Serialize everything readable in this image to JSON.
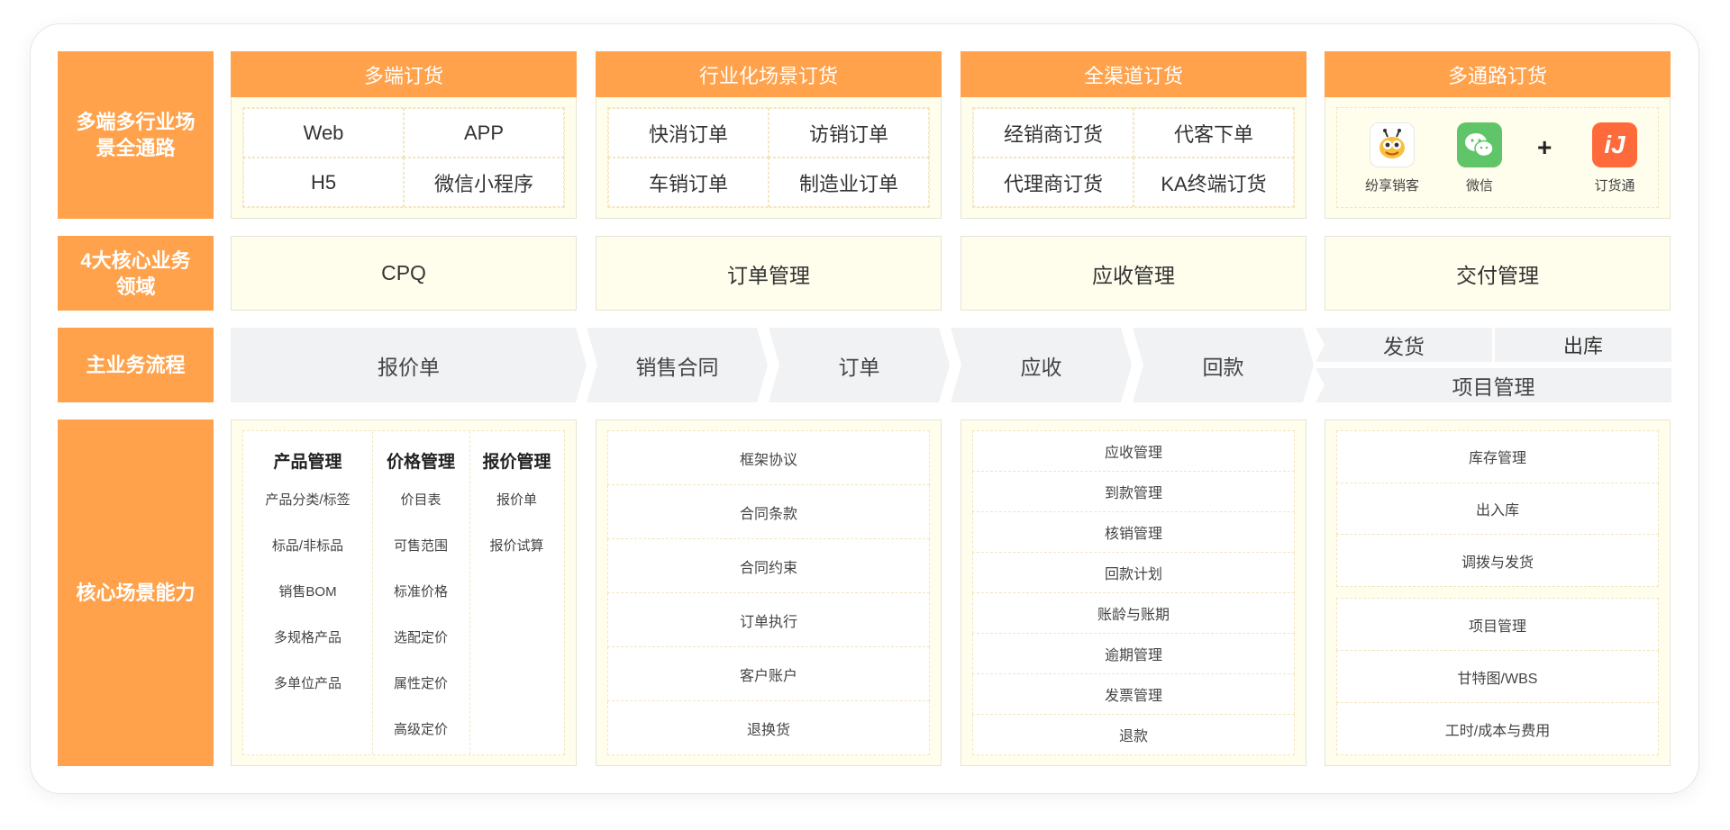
{
  "rows": {
    "channels": "多端多行业场景全通路",
    "domains": "4大核心业务领域",
    "process": "主业务流程",
    "capabilities": "核心场景能力"
  },
  "channels": [
    {
      "title": "多端订货",
      "items": [
        "Web",
        "APP",
        "H5",
        "微信小程序"
      ]
    },
    {
      "title": "行业化场景订货",
      "items": [
        "快消订单",
        "访销订单",
        "车销订单",
        "制造业订单"
      ]
    },
    {
      "title": "全渠道订货",
      "items": [
        "经销商订货",
        "代客下单",
        "代理商订货",
        "KA终端订货"
      ]
    },
    {
      "title": "多通路订货",
      "apps": [
        {
          "name": "纷享销客",
          "icon": "fenxiang-bee-icon",
          "color": "#f6c23e"
        },
        {
          "name": "微信",
          "icon": "wechat-icon",
          "color": "#5fc568"
        },
        {
          "name": "订货通",
          "icon": "dinghuotong-icon",
          "color": "#ff6a3a",
          "glyph": "iJ"
        }
      ],
      "plus": "+"
    }
  ],
  "domains": [
    "CPQ",
    "订单管理",
    "应收管理",
    "交付管理"
  ],
  "process": {
    "steps": [
      "报价单",
      "销售合同",
      "订单",
      "应收",
      "回款"
    ],
    "delivery": [
      "发货",
      "出库"
    ],
    "project": "项目管理"
  },
  "capabilities": {
    "cpq": [
      {
        "title": "产品管理",
        "items": [
          "产品分类/标签",
          "标品/非标品",
          "销售BOM",
          "多规格产品",
          "多单位产品"
        ]
      },
      {
        "title": "价格管理",
        "items": [
          "价目表",
          "可售范围",
          "标准价格",
          "选配定价",
          "属性定价",
          "高级定价"
        ]
      },
      {
        "title": "报价管理",
        "items": [
          "报价单",
          "报价试算"
        ]
      }
    ],
    "order": [
      "框架协议",
      "合同条款",
      "合同约束",
      "订单执行",
      "客户账户",
      "退换货"
    ],
    "receivable": [
      "应收管理",
      "到款管理",
      "核销管理",
      "回款计划",
      "账龄与账期",
      "逾期管理",
      "发票管理",
      "退款"
    ],
    "delivery_a": [
      "库存管理",
      "出入库",
      "调拨与发货"
    ],
    "delivery_b": [
      "项目管理",
      "甘特图/WBS",
      "工时/成本与费用"
    ]
  },
  "colors": {
    "orange": "#ffa24b",
    "cream": "#fffdeb",
    "grey": "#f1f2f4"
  }
}
